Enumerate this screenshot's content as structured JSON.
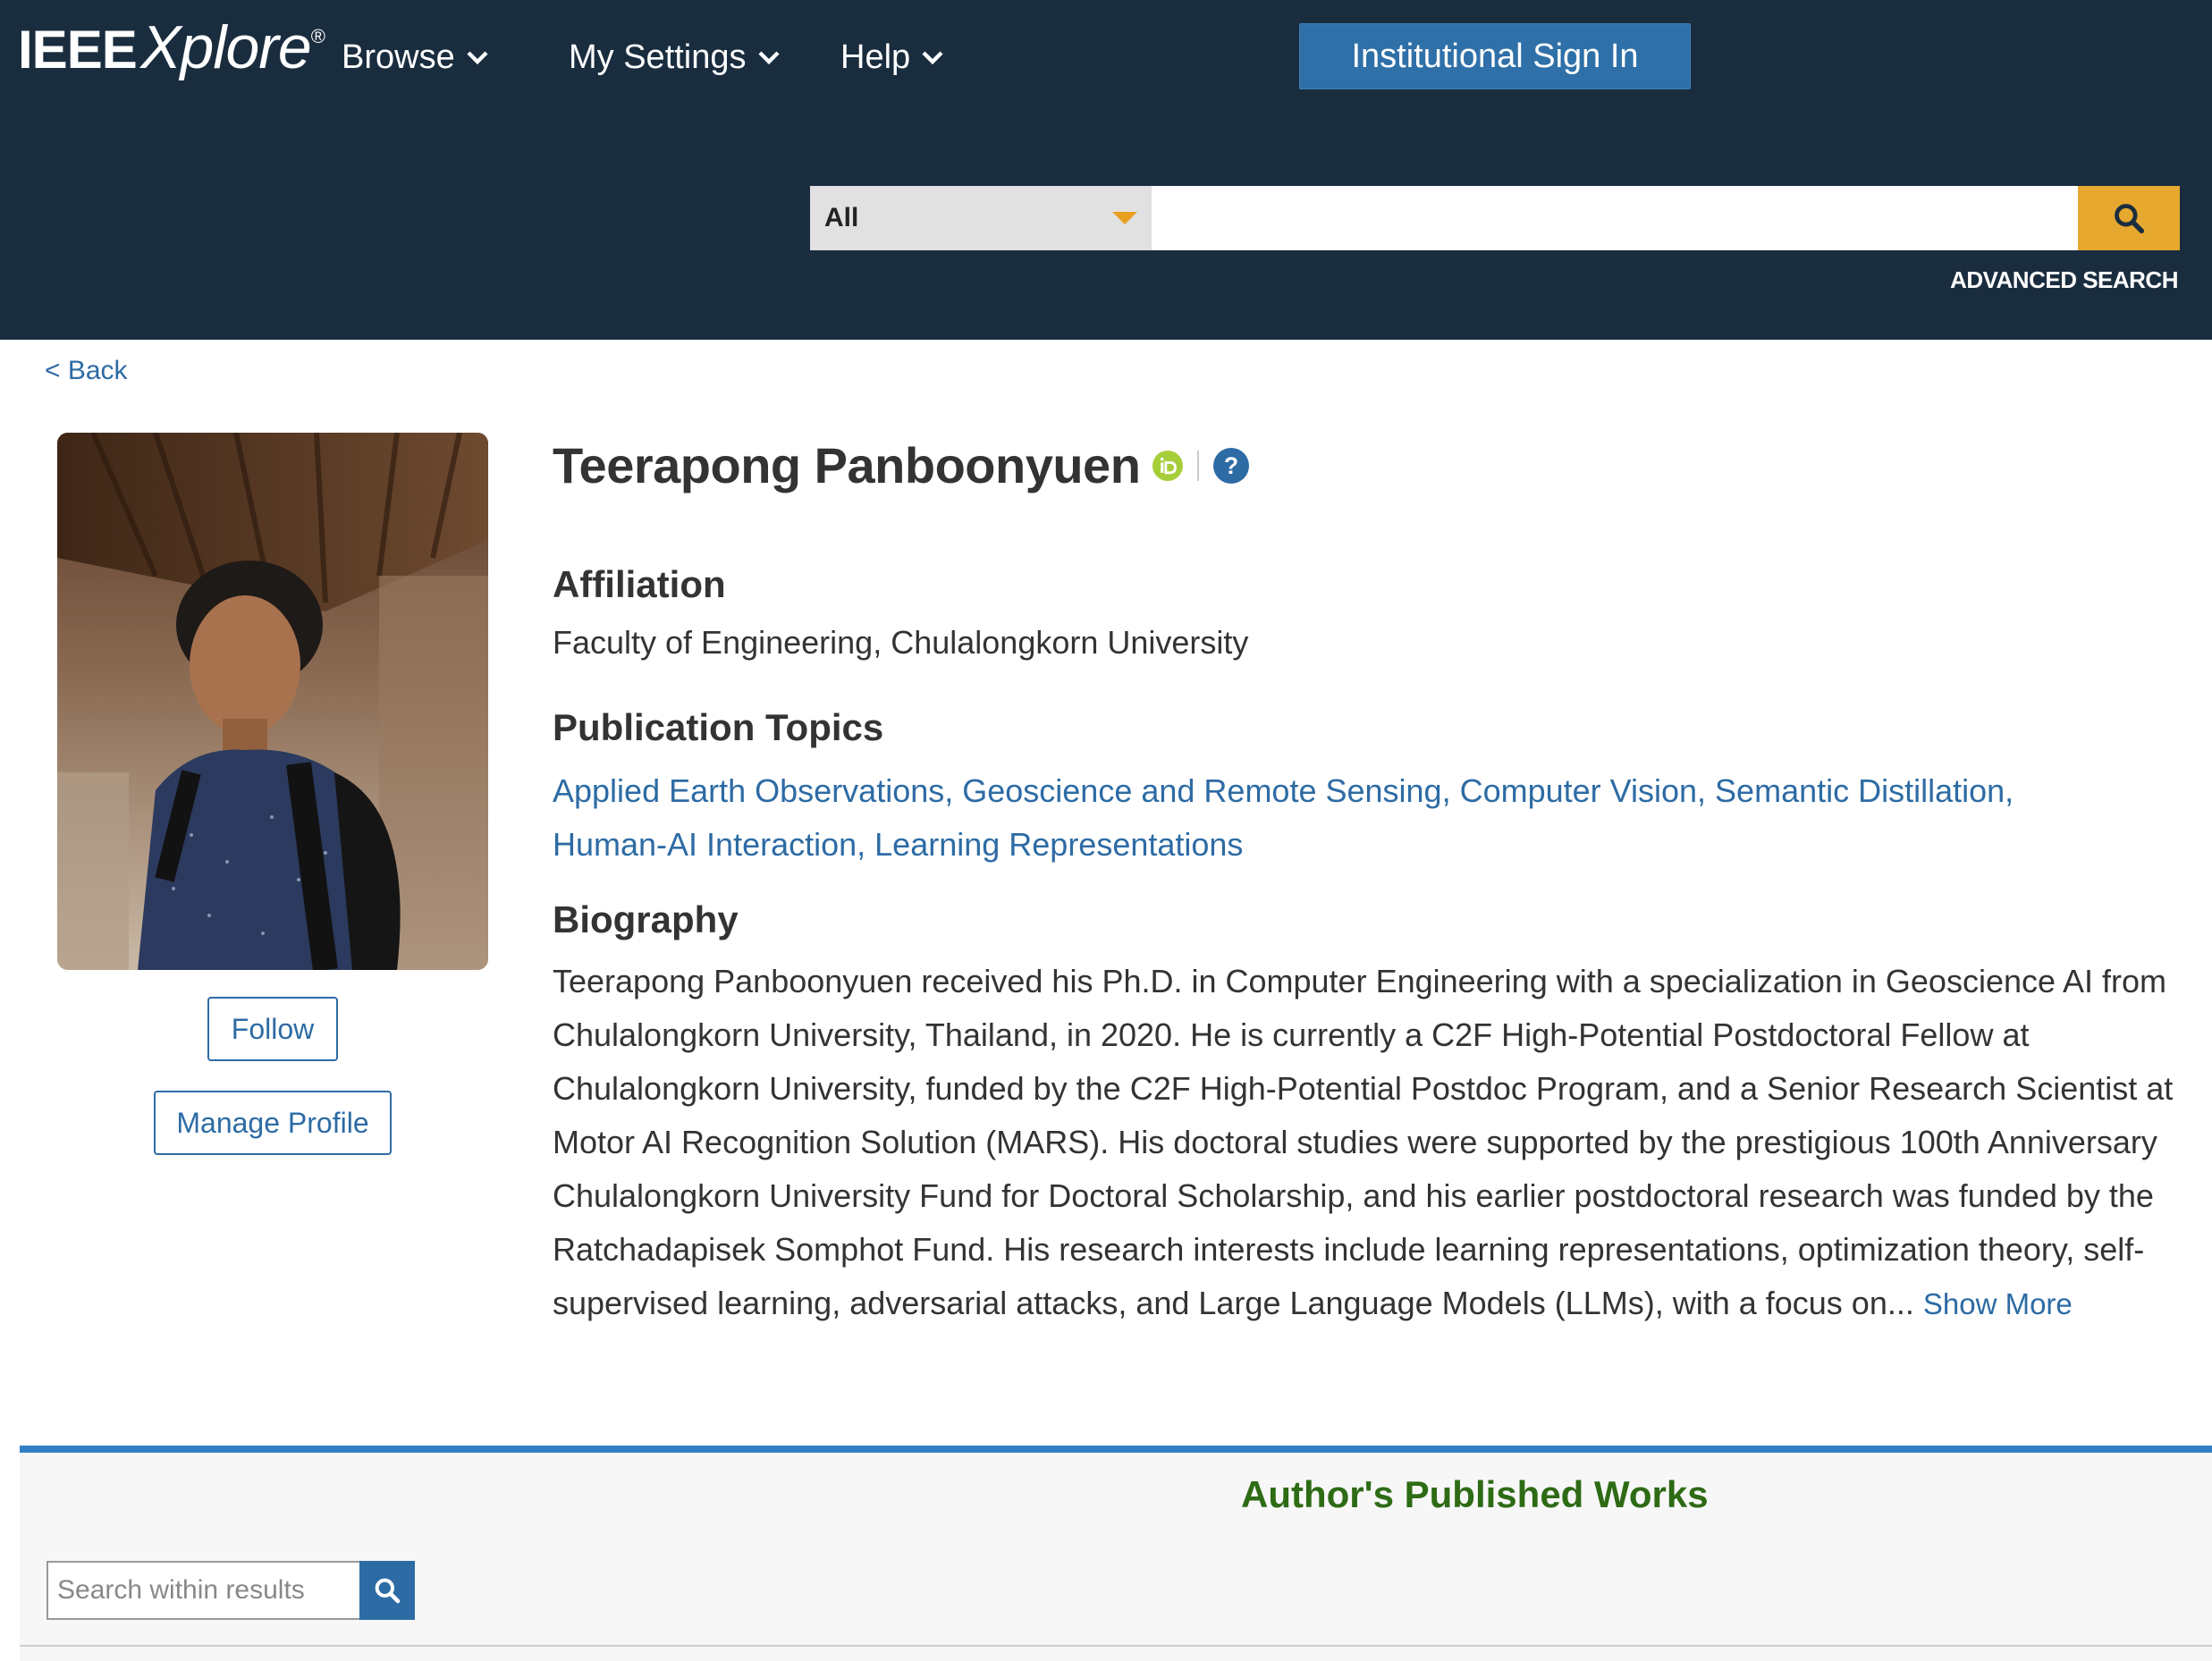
{
  "header": {
    "logo_main": "IEEE",
    "logo_sub": "Xplore",
    "logo_reg": "®",
    "nav": [
      {
        "label": "Browse"
      },
      {
        "label": "My Settings"
      },
      {
        "label": "Help"
      }
    ],
    "signin_label": "Institutional Sign In",
    "search": {
      "scope": "All",
      "value": "",
      "advanced_label": "ADVANCED SEARCH"
    }
  },
  "back_label": "< Back",
  "profile": {
    "name": "Teerapong Panboonyuen",
    "follow_label": "Follow",
    "manage_label": "Manage Profile",
    "affiliation_heading": "Affiliation",
    "affiliation": "Faculty of Engineering, Chulalongkorn University",
    "topics_heading": "Publication Topics",
    "topics_line1": "Applied Earth Observations, Geoscience and Remote Sensing, Computer Vision, Semantic Distillation,",
    "topics_line2": "Human-AI Interaction, Learning Representations",
    "biography_heading": "Biography",
    "biography": "Teerapong Panboonyuen received his Ph.D. in Computer Engineering with a specialization in Geoscience AI from Chulalongkorn University, Thailand, in 2020. He is currently a C2F High-Potential Postdoctoral Fellow at Chulalongkorn University, funded by the C2F High-Potential Postdoc Program, and a Senior Research Scientist at Motor AI Recognition Solution (MARS). His doctoral studies were supported by the prestigious 100th Anniversary Chulalongkorn University Fund for Doctoral Scholarship, and his earlier postdoctoral research was funded by the Ratchadapisek Somphot Fund. His research interests include learning representations, optimization theory, self-supervised learning, adversarial attacks, and Large Language Models (LLMs), with a focus on...",
    "show_more_label": "Show More"
  },
  "works": {
    "title": "Author's Published Works",
    "search_placeholder": "Search within results"
  },
  "colors": {
    "header_bg": "#1a2d3f",
    "link": "#2d6ba4",
    "search_accent": "#e6a82e",
    "works_title": "#2e6b15",
    "works_border": "#3180c6",
    "orcid": "#a6ce39"
  },
  "icons": {
    "search": "search-icon",
    "chevron": "chevron-down-icon",
    "orcid": "orcid-icon",
    "help": "help-icon"
  }
}
